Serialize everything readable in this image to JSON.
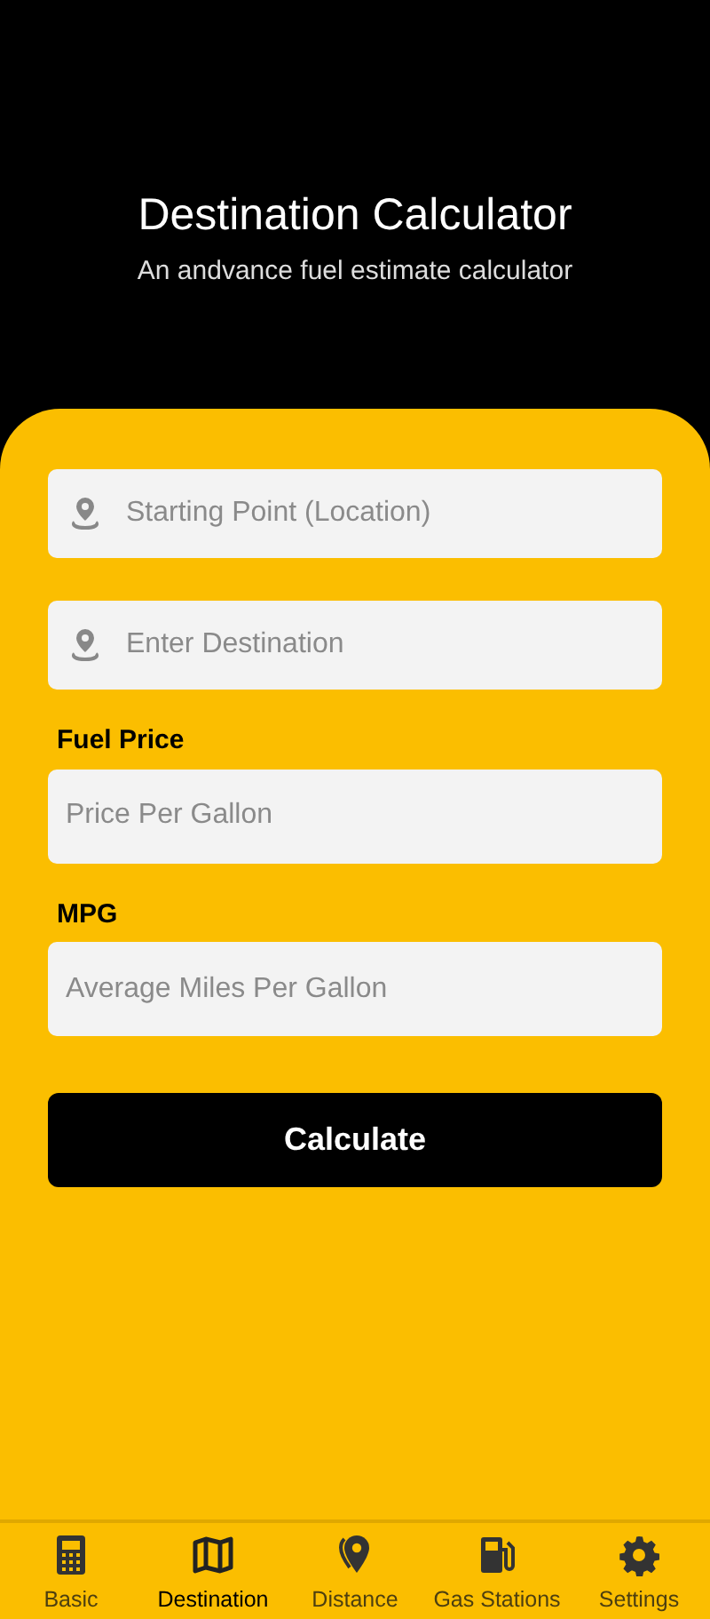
{
  "header": {
    "title": "Destination Calculator",
    "subtitle": "An andvance fuel estimate calculator"
  },
  "fields": [
    {
      "kind": "icon",
      "placeholder": "Starting Point (Location)"
    },
    {
      "kind": "icon",
      "placeholder": "Enter Destination"
    },
    {
      "kind": "labeled",
      "label": "Fuel Price",
      "placeholder": "Price Per Gallon"
    },
    {
      "kind": "labeled",
      "label": "MPG",
      "placeholder": "Average Miles Per Gallon"
    }
  ],
  "button": "Calculate",
  "tabs": [
    {
      "label": "Basic",
      "selected": false
    },
    {
      "label": "Destination",
      "selected": true
    },
    {
      "label": "Distance",
      "selected": false
    },
    {
      "label": "Gas Stations",
      "selected": false
    },
    {
      "label": "Settings",
      "selected": false
    }
  ]
}
